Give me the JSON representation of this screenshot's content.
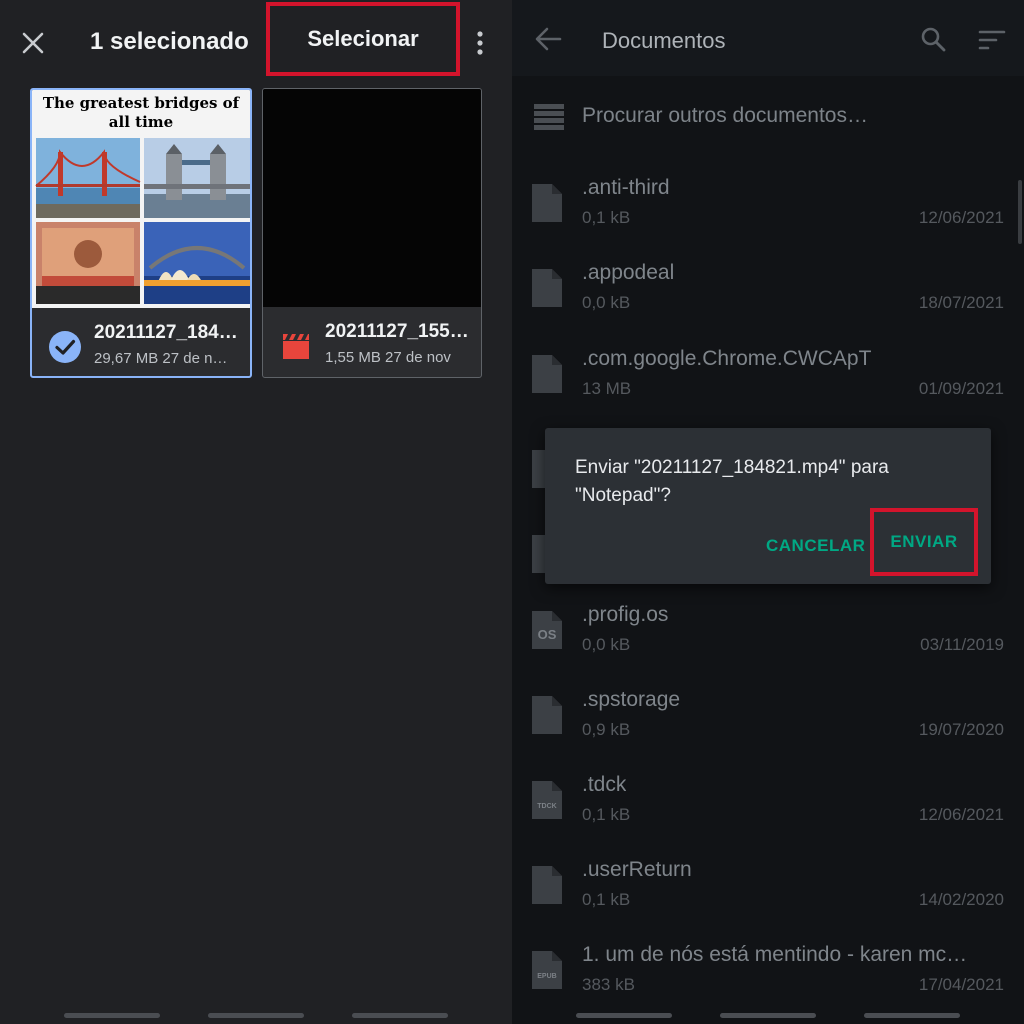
{
  "left": {
    "header": {
      "selected_count": "1 selecionado",
      "select_label": "Selecionar"
    },
    "files": [
      {
        "name": "20211127_184…",
        "info": "29,67 MB 27 de n…",
        "selected": true,
        "thumb_title": "The greatest bridges of all time"
      },
      {
        "name": "20211127_155…",
        "info": "1,55 MB 27 de nov",
        "selected": false
      }
    ]
  },
  "right": {
    "appbar": {
      "title": "Documentos"
    },
    "browse_label": "Procurar outros documentos…",
    "files": [
      {
        "name": ".anti-third",
        "size": "0,1 kB",
        "date": "12/06/2021",
        "icon_label": ""
      },
      {
        "name": ".appodeal",
        "size": "0,0 kB",
        "date": "18/07/2021",
        "icon_label": ""
      },
      {
        "name": ".com.google.Chrome.CWCApT",
        "size": "13 MB",
        "date": "01/09/2021",
        "icon_label": ""
      },
      {
        "name": ".profig.os",
        "size": "0,0 kB",
        "date": "03/11/2019",
        "icon_label": "OS"
      },
      {
        "name": ".spstorage",
        "size": "0,9 kB",
        "date": "19/07/2020",
        "icon_label": ""
      },
      {
        "name": ".tdck",
        "size": "0,1 kB",
        "date": "12/06/2021",
        "icon_label": "TDCK"
      },
      {
        "name": ".userReturn",
        "size": "0,1 kB",
        "date": "14/02/2020",
        "icon_label": ""
      },
      {
        "name": "1. um de nós está mentindo - karen mc…",
        "size": "383 kB",
        "date": "17/04/2021",
        "icon_label": "EPUB"
      }
    ],
    "dialog": {
      "message": "Enviar \"20211127_184821.mp4\" para \"Notepad\"?",
      "cancel_label": "CANCELAR",
      "send_label": "ENVIAR"
    }
  },
  "colors": {
    "accent_green": "#00a884",
    "highlight_red": "#d3142c",
    "selection_blue": "#8ab4f8",
    "video_red": "#e8453c"
  }
}
